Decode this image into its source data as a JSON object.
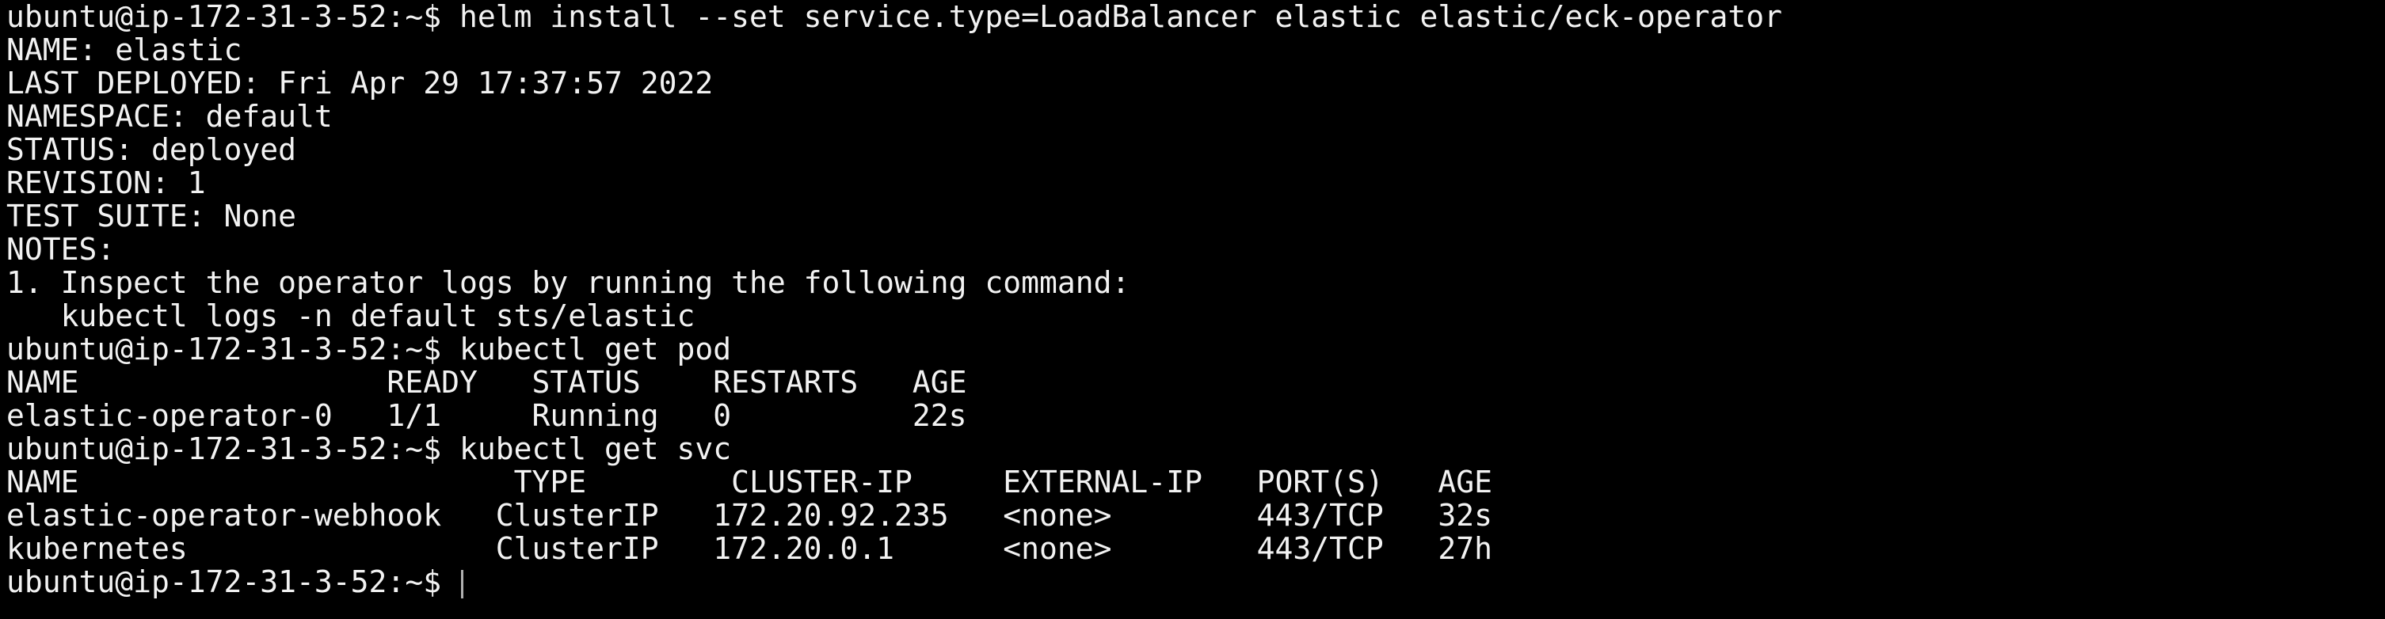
{
  "terminal": {
    "background": "#000000",
    "foreground": "#f2f2f2",
    "lines": [
      "ubuntu@ip-172-31-3-52:~$ helm install --set service.type=LoadBalancer elastic elastic/eck-operator",
      "NAME: elastic",
      "LAST DEPLOYED: Fri Apr 29 17:37:57 2022",
      "NAMESPACE: default",
      "STATUS: deployed",
      "REVISION: 1",
      "TEST SUITE: None",
      "NOTES:",
      "1. Inspect the operator logs by running the following command:",
      "   kubectl logs -n default sts/elastic",
      "ubuntu@ip-172-31-3-52:~$ kubectl get pod",
      "NAME                 READY   STATUS    RESTARTS   AGE",
      "elastic-operator-0   1/1     Running   0          22s",
      "ubuntu@ip-172-31-3-52:~$ kubectl get svc",
      "NAME                        TYPE        CLUSTER-IP     EXTERNAL-IP   PORT(S)   AGE",
      "elastic-operator-webhook   ClusterIP   172.20.92.235   <none>        443/TCP   32s",
      "kubernetes                 ClusterIP   172.20.0.1      <none>        443/TCP   27h"
    ],
    "prompt": "ubuntu@ip-172-31-3-52:~$ "
  }
}
